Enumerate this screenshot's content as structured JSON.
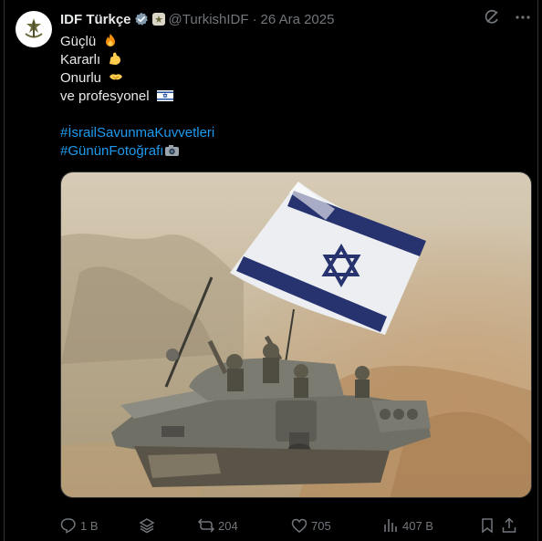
{
  "tweet": {
    "author_name": "IDF Türkçe",
    "handle": "@TurkishIDF",
    "separator": "·",
    "date": "26 Ara 2025",
    "lines": [
      "Güçlü",
      "Kararlı",
      "Onurlu",
      "ve profesyonel"
    ],
    "hashtags": [
      "#İsrailSavunmaKuvvetleri",
      "#GününFotoğrafı"
    ],
    "emojis": [
      "fire-emoji",
      "flexed-biceps-emoji",
      "handshake-emoji",
      "israel-flag-emoji",
      "camera-emoji"
    ]
  },
  "actions": {
    "replies": "1 B",
    "retweets": "204",
    "likes": "705",
    "views": "407 B"
  },
  "colors": {
    "background": "#000000",
    "text": "#e7e9ea",
    "secondary": "#71767b",
    "link": "#1d9bf0",
    "verified": "#829aab"
  }
}
